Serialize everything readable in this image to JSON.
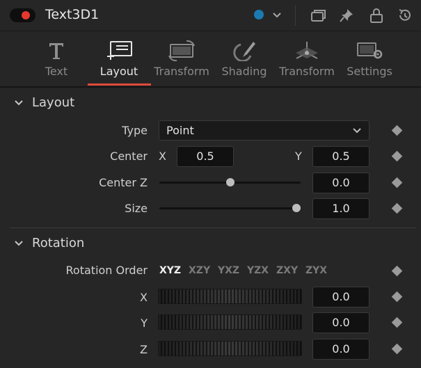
{
  "header": {
    "tool_name": "Text3D1",
    "color_tag": "#1b7ab0",
    "toggle_color": "#e5372d",
    "icons": [
      "color-chevron-icon",
      "windows-icon",
      "pin-icon",
      "lock-icon",
      "reset-icon"
    ]
  },
  "tabs": [
    {
      "label": "Text",
      "icon": "text-icon"
    },
    {
      "label": "Layout",
      "icon": "layout-icon"
    },
    {
      "label": "Transform",
      "icon": "transform-icon"
    },
    {
      "label": "Shading",
      "icon": "shading-icon"
    },
    {
      "label": "Transform",
      "icon": "transform-3d-icon"
    },
    {
      "label": "Settings",
      "icon": "settings-icon"
    }
  ],
  "active_tab": "Layout",
  "accent": "#e0493a",
  "layout": {
    "title": "Layout",
    "type_label": "Type",
    "type_value": "Point",
    "center_label": "Center",
    "center_x_label": "X",
    "center_x": "0.5",
    "center_y_label": "Y",
    "center_y": "0.5",
    "center_z_label": "Center Z",
    "center_z": "0.0",
    "center_z_level": 0.5,
    "size_label": "Size",
    "size": "1.0",
    "size_level": 1.0
  },
  "rotation": {
    "title": "Rotation",
    "order_label": "Rotation Order",
    "orders": [
      "XYZ",
      "XZY",
      "YXZ",
      "YZX",
      "ZXY",
      "ZYX"
    ],
    "selected_order": "XYZ",
    "x_label": "X",
    "x": "0.0",
    "y_label": "Y",
    "y": "0.0",
    "z_label": "Z",
    "z": "0.0"
  }
}
